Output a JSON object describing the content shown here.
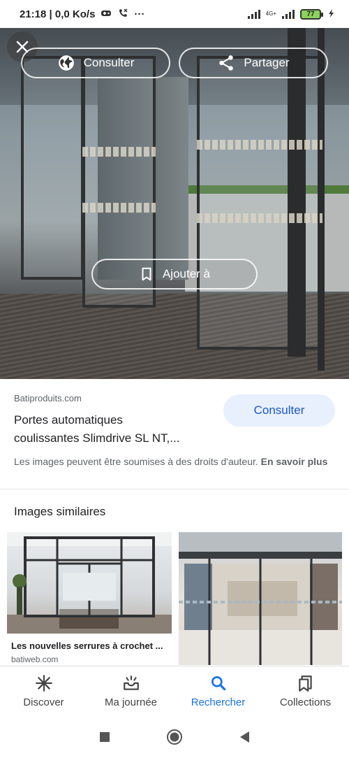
{
  "status_bar": {
    "time_speed": "21:18 | 0,0 Ko/s",
    "more": "···",
    "network_label": "4G+",
    "battery": "77"
  },
  "hero": {
    "consult_label": "Consulter",
    "share_label": "Partager",
    "add_to_label": "Ajouter à"
  },
  "result": {
    "source": "Batiproduits.com",
    "title_line1": "Portes automatiques",
    "title_line2": "coulissantes Slimdrive SL NT,...",
    "consult_button": "Consulter",
    "rights_text": "Les images peuvent être soumises à des droits d'auteur.",
    "rights_link": "En savoir plus"
  },
  "similar": {
    "heading": "Images similaires",
    "items": [
      {
        "caption": "Les nouvelles serrures à crochet ...",
        "source": "batiweb.com"
      }
    ]
  },
  "bottom_nav": [
    {
      "label": "Discover",
      "icon": "asterisk-icon"
    },
    {
      "label": "Ma journée",
      "icon": "inbox-sparkle-icon"
    },
    {
      "label": "Rechercher",
      "icon": "search-icon"
    },
    {
      "label": "Collections",
      "icon": "collections-icon"
    }
  ],
  "colors": {
    "accent": "#1a73e8",
    "consult_bg": "#e8f0fe",
    "battery_fill": "#8bd35a"
  }
}
